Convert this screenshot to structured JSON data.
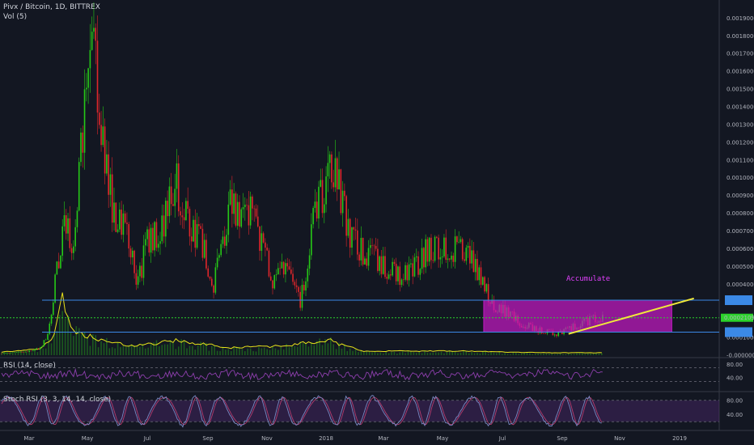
{
  "header": {
    "title": "Pivx / Bitcoin, 1D, BITTREX",
    "volume_label": "Vol (5)",
    "rsi_label": "RSI (14, close)",
    "stoch_label": "Stoch RSI (3, 3, 14, 14, close)"
  },
  "annotation": {
    "accumulate": "Accumulate"
  },
  "badge": {
    "last_price": "0.00021099"
  },
  "colors": {
    "background": "#131722",
    "up": "#26c917",
    "down": "#e0262b",
    "volume_line": "#e8e21a",
    "rsi_line": "#8e3fae",
    "stoch_k": "#7b88c4",
    "stoch_d": "#b33c6e",
    "accumulate_box": "#c219c2",
    "support_line": "#3b89e6",
    "trend_line": "#f0e83a",
    "price_dotted": "#2bd32b"
  },
  "chart_data": {
    "type": "candlestick",
    "symbol": "Pivx / Bitcoin",
    "interval": "1D",
    "exchange": "BITTREX",
    "price_axis": {
      "ticks": [
        "0.00190000",
        "0.00180000",
        "0.00170000",
        "0.00160000",
        "0.00150000",
        "0.00140000",
        "0.00130000",
        "0.00120000",
        "0.00110000",
        "0.00100000",
        "0.00090000",
        "0.00080000",
        "0.00070000",
        "0.00060000",
        "0.00050000",
        "0.00040000",
        "0.00021099",
        "0.00010000",
        "-0.00000000"
      ],
      "ylim": [
        0,
        0.0019
      ]
    },
    "date_axis": {
      "labels": [
        "Mar",
        "May",
        "Jul",
        "Sep",
        "Nov",
        "2018",
        "Mar",
        "May",
        "Jul",
        "Sep",
        "Nov",
        "2019"
      ],
      "range": [
        "2017-01-18",
        "2019-02-10"
      ]
    },
    "price_path": [
      {
        "date": "2017-01-18",
        "value": 1e-05
      },
      {
        "date": "2017-02-15",
        "value": 2e-05
      },
      {
        "date": "2017-03-01",
        "value": 4e-05
      },
      {
        "date": "2017-03-10",
        "value": 0.00012
      },
      {
        "date": "2017-03-18",
        "value": 0.00045
      },
      {
        "date": "2017-03-28",
        "value": 0.00075
      },
      {
        "date": "2017-04-05",
        "value": 0.0006
      },
      {
        "date": "2017-04-15",
        "value": 0.0012
      },
      {
        "date": "2017-04-22",
        "value": 0.0015
      },
      {
        "date": "2017-04-26",
        "value": 0.0017
      },
      {
        "date": "2017-05-01",
        "value": 0.0016
      },
      {
        "date": "2017-05-10",
        "value": 0.0011
      },
      {
        "date": "2017-05-20",
        "value": 0.0008
      },
      {
        "date": "2017-06-05",
        "value": 0.00065
      },
      {
        "date": "2017-06-15",
        "value": 0.0004
      },
      {
        "date": "2017-06-25",
        "value": 0.00065
      },
      {
        "date": "2017-07-10",
        "value": 0.0007
      },
      {
        "date": "2017-07-25",
        "value": 0.001
      },
      {
        "date": "2017-08-05",
        "value": 0.0008
      },
      {
        "date": "2017-08-15",
        "value": 0.0007
      },
      {
        "date": "2017-08-25",
        "value": 0.0006
      },
      {
        "date": "2017-09-05",
        "value": 0.0004
      },
      {
        "date": "2017-09-12",
        "value": 0.00055
      },
      {
        "date": "2017-09-25",
        "value": 0.00088
      },
      {
        "date": "2017-10-05",
        "value": 0.00075
      },
      {
        "date": "2017-10-15",
        "value": 0.0008
      },
      {
        "date": "2017-10-28",
        "value": 0.0006
      },
      {
        "date": "2017-11-10",
        "value": 0.0004
      },
      {
        "date": "2017-11-20",
        "value": 0.0005
      },
      {
        "date": "2017-12-01",
        "value": 0.00037
      },
      {
        "date": "2017-12-08",
        "value": 0.0003
      },
      {
        "date": "2017-12-15",
        "value": 0.0005
      },
      {
        "date": "2017-12-25",
        "value": 0.00085
      },
      {
        "date": "2018-01-05",
        "value": 0.00095
      },
      {
        "date": "2018-01-12",
        "value": 0.0011
      },
      {
        "date": "2018-01-20",
        "value": 0.00095
      },
      {
        "date": "2018-01-28",
        "value": 0.0007
      },
      {
        "date": "2018-02-10",
        "value": 0.0006
      },
      {
        "date": "2018-02-25",
        "value": 0.00055
      },
      {
        "date": "2018-03-10",
        "value": 0.0005
      },
      {
        "date": "2018-03-25",
        "value": 0.00045
      },
      {
        "date": "2018-04-10",
        "value": 0.00048
      },
      {
        "date": "2018-04-25",
        "value": 0.0006
      },
      {
        "date": "2018-05-10",
        "value": 0.00062
      },
      {
        "date": "2018-05-25",
        "value": 0.0006
      },
      {
        "date": "2018-06-10",
        "value": 0.00055
      },
      {
        "date": "2018-06-25",
        "value": 0.0004
      },
      {
        "date": "2018-07-05",
        "value": 0.00028
      },
      {
        "date": "2018-07-20",
        "value": 0.00024
      },
      {
        "date": "2018-08-05",
        "value": 0.00018
      },
      {
        "date": "2018-08-25",
        "value": 0.00014
      },
      {
        "date": "2018-09-15",
        "value": 0.00012
      },
      {
        "date": "2018-10-01",
        "value": 0.00016
      },
      {
        "date": "2018-10-20",
        "value": 0.0002
      },
      {
        "date": "2018-11-01",
        "value": 0.00021
      }
    ],
    "volume": {
      "name": "Vol (5)",
      "path": [
        {
          "date": "2017-01-18",
          "value": 0.04
        },
        {
          "date": "2017-03-01",
          "value": 0.1
        },
        {
          "date": "2017-03-15",
          "value": 0.3
        },
        {
          "date": "2017-03-25",
          "value": 1.0
        },
        {
          "date": "2017-04-05",
          "value": 0.45
        },
        {
          "date": "2017-04-20",
          "value": 0.35
        },
        {
          "date": "2017-05-10",
          "value": 0.25
        },
        {
          "date": "2017-06-10",
          "value": 0.15
        },
        {
          "date": "2017-07-25",
          "value": 0.25
        },
        {
          "date": "2017-09-25",
          "value": 0.12
        },
        {
          "date": "2017-11-15",
          "value": 0.15
        },
        {
          "date": "2017-12-10",
          "value": 0.2
        },
        {
          "date": "2018-01-12",
          "value": 0.25
        },
        {
          "date": "2018-01-20",
          "value": 0.18
        },
        {
          "date": "2018-02-15",
          "value": 0.06
        },
        {
          "date": "2018-06-01",
          "value": 0.06
        },
        {
          "date": "2018-09-01",
          "value": 0.03
        },
        {
          "date": "2018-11-01",
          "value": 0.03
        }
      ]
    },
    "rsi": {
      "name": "RSI (14, close)",
      "ticks": [
        80,
        40
      ],
      "band": [
        70,
        30
      ]
    },
    "stoch_rsi": {
      "name": "Stoch RSI (3, 3, 14, 14, close)",
      "ticks": [
        80,
        40
      ],
      "band": [
        80,
        20
      ]
    },
    "annotations": {
      "horizontal_lines": [
        0.00031,
        0.00013
      ],
      "dotted_price_line": 0.00021099,
      "accumulate_box": {
        "from": "2018-06-25",
        "to": "2019-01-15",
        "high": 0.00031,
        "low": 0.00013,
        "label": "Accumulate"
      },
      "trend_line": [
        {
          "date": "2018-09-25",
          "value": 0.00012
        },
        {
          "date": "2019-02-08",
          "value": 0.00032
        }
      ]
    }
  }
}
